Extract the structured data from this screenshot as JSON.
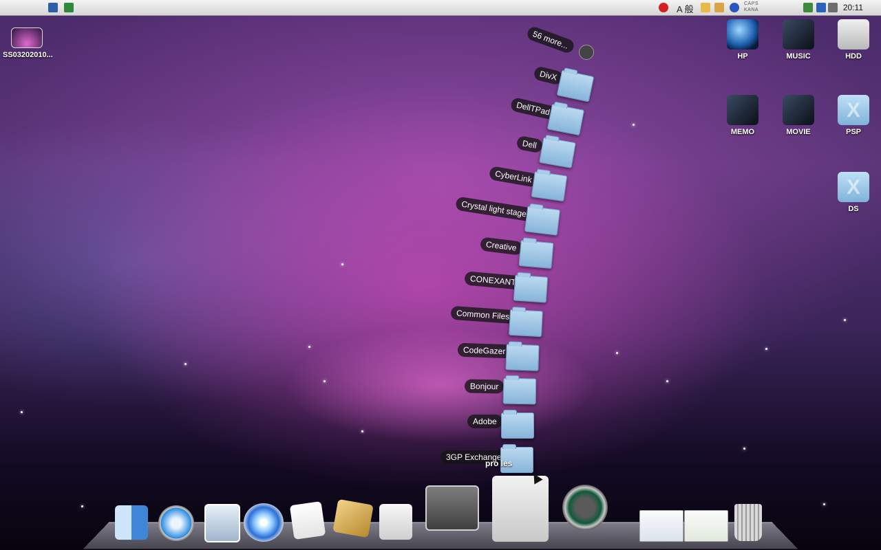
{
  "menubar": {
    "apple_glyph": "",
    "ime_text": "A 般",
    "caps_line1": "CAPS",
    "caps_line2": "KANA",
    "clock": "20:11"
  },
  "desktop_icons": {
    "screenshot": "SS03202010...",
    "hp": "HP",
    "music": "MUSIC",
    "hdd": "HDD",
    "memo": "MEMO",
    "movie": "MOVIE",
    "psp": "PSP",
    "ds": "DS"
  },
  "stack": {
    "more_label": "56 more...",
    "title_visible": "pro les",
    "folders": [
      "DivX",
      "DellTPad",
      "Dell",
      "CyberLink",
      "Crystal light stage",
      "Creative",
      "CONEXANT",
      "Common Files",
      "CodeGazer",
      "Bonjour",
      "Adobe",
      "3GP Exchange"
    ]
  },
  "dock": {
    "items": [
      "finder-icon",
      "safari-icon",
      "mail-icon",
      "itunes-icon",
      "textedit-icon",
      "script-editor-icon",
      "grab-icon",
      "system-preferences-icon",
      "program-files-stack-icon",
      "time-machine-icon",
      "window-thumbnail-1",
      "window-thumbnail-2",
      "trash-icon"
    ]
  },
  "colors": {
    "accent_folder": "#87b4d9",
    "menubar": "#e8e8e8"
  }
}
